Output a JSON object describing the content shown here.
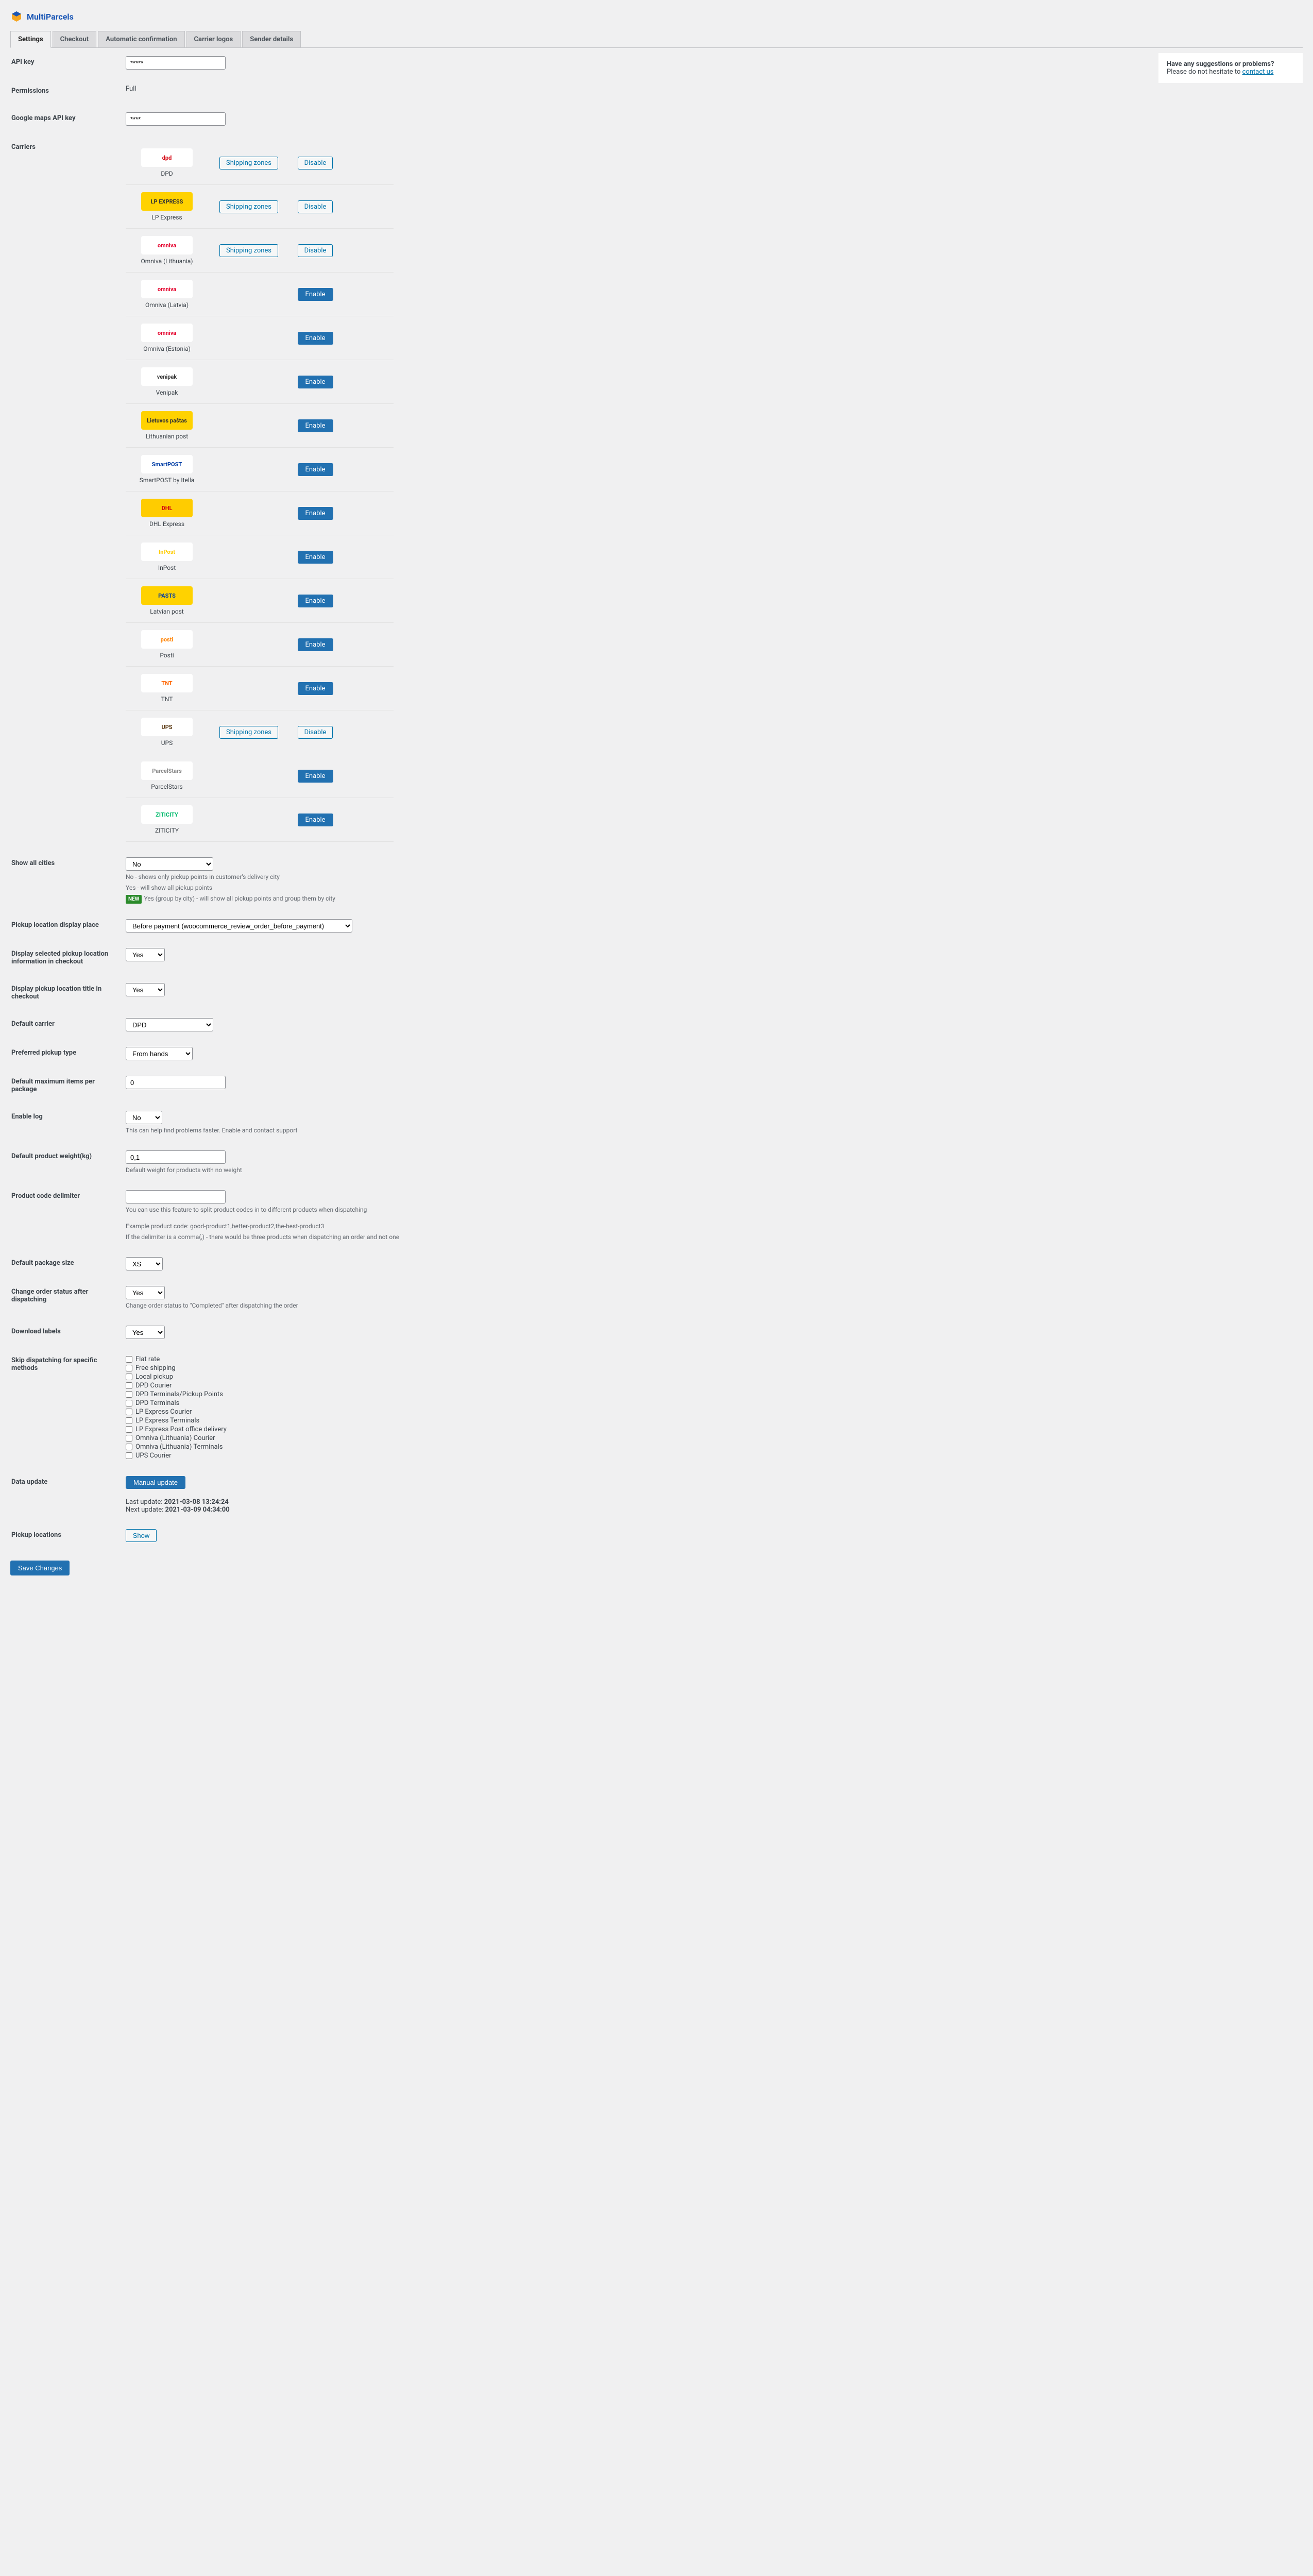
{
  "brand": "MultiParcels",
  "tabs": [
    "Settings",
    "Checkout",
    "Automatic confirmation",
    "Carrier logos",
    "Sender details"
  ],
  "activeTab": 0,
  "help": {
    "title": "Have any suggestions or problems?",
    "text": "Please do not hesitate to ",
    "link": "contact us"
  },
  "labels": {
    "apiKey": "API key",
    "permissions": "Permissions",
    "gmapsKey": "Google maps API key",
    "carriers": "Carriers",
    "showAllCities": "Show all cities",
    "pickupLocation": "Pickup location display place",
    "displaySelPickup": "Display selected pickup location information in checkout",
    "displayPickupTitle": "Display pickup location title in checkout",
    "defaultCarrier": "Default carrier",
    "prefPickup": "Preferred pickup type",
    "maxItems": "Default maximum items per package",
    "enableLog": "Enable log",
    "defWeight": "Default product weight(kg)",
    "prodDelim": "Product code delimiter",
    "defPkgSize": "Default package size",
    "changeOrder": "Change order status after dispatching",
    "downloadLabels": "Download labels",
    "skipDispatch": "Skip dispatching for specific methods",
    "dataUpdate": "Data update",
    "pickupLocations": "Pickup locations"
  },
  "values": {
    "apiKey": "*****",
    "permissions": "Full",
    "gmapsKey": "****",
    "showAllCities": "No",
    "pickupLocation": "Before payment (woocommerce_review_order_before_payment)",
    "displaySelPickup": "Yes",
    "displayPickupTitle": "Yes",
    "defaultCarrier": "DPD",
    "prefPickup": "From hands",
    "maxItems": "0",
    "enableLog": "No",
    "defWeight": "0,1",
    "prodDelim": "",
    "defPkgSize": "XS",
    "changeOrder": "Yes",
    "downloadLabels": "Yes"
  },
  "descriptions": {
    "showAll1": "No - shows only pickup points in customer's delivery city",
    "showAll2": "Yes - will show all pickup points",
    "showAll3": "Yes (group by city) - will show all pickup points and group them by city",
    "enableLog": "This can help find problems faster. Enable and contact support",
    "defWeight": "Default weight for products with no weight",
    "delim1": "You can use this feature to split product codes in to different products when dispatching",
    "delim2": "Example product code: good-product1,better-product2,the-best-product3",
    "delim3": "If the delimiter is a comma(,) - there would be three products when dispatching an order and not one",
    "changeOrder": "Change order status to \"Completed\" after dispatching the order"
  },
  "buttons": {
    "shippingZones": "Shipping zones",
    "enable": "Enable",
    "disable": "Disable",
    "manualUpdate": "Manual update",
    "show": "Show",
    "save": "Save Changes"
  },
  "badges": {
    "new": "NEW"
  },
  "dataUpdate": {
    "lastLabel": "Last update: ",
    "lastValue": "2021-03-08 13:24:24",
    "nextLabel": "Next update: ",
    "nextValue": "2021-03-09 04:34:00"
  },
  "carriers": [
    {
      "name": "DPD",
      "enabled": true,
      "logoBg": "#ffffff",
      "logoColor": "#d40511",
      "logoText": "dpd"
    },
    {
      "name": "LP Express",
      "enabled": true,
      "logoBg": "#ffd200",
      "logoColor": "#333",
      "logoText": "LP EXPRESS"
    },
    {
      "name": "Omniva (Lithuania)",
      "enabled": true,
      "logoBg": "#ffffff",
      "logoColor": "#e4002b",
      "logoText": "omniva"
    },
    {
      "name": "Omniva (Latvia)",
      "enabled": false,
      "logoBg": "#ffffff",
      "logoColor": "#e4002b",
      "logoText": "omniva"
    },
    {
      "name": "Omniva (Estonia)",
      "enabled": false,
      "logoBg": "#ffffff",
      "logoColor": "#e4002b",
      "logoText": "omniva"
    },
    {
      "name": "Venipak",
      "enabled": false,
      "logoBg": "#ffffff",
      "logoColor": "#333",
      "logoText": "venipak"
    },
    {
      "name": "Lithuanian post",
      "enabled": false,
      "logoBg": "#ffd200",
      "logoColor": "#333",
      "logoText": "Lietuvos paštas"
    },
    {
      "name": "SmartPOST by Itella",
      "enabled": false,
      "logoBg": "#ffffff",
      "logoColor": "#003da5",
      "logoText": "SmartPOST"
    },
    {
      "name": "DHL Express",
      "enabled": false,
      "logoBg": "#ffcc00",
      "logoColor": "#d40511",
      "logoText": "DHL"
    },
    {
      "name": "InPost",
      "enabled": false,
      "logoBg": "#ffffff",
      "logoColor": "#ffcc00",
      "logoText": "InPost"
    },
    {
      "name": "Latvian post",
      "enabled": false,
      "logoBg": "#ffd200",
      "logoColor": "#003da5",
      "logoText": "PASTS"
    },
    {
      "name": "Posti",
      "enabled": false,
      "logoBg": "#ffffff",
      "logoColor": "#ff8200",
      "logoText": "posti"
    },
    {
      "name": "TNT",
      "enabled": false,
      "logoBg": "#ffffff",
      "logoColor": "#ff6600",
      "logoText": "TNT"
    },
    {
      "name": "UPS",
      "enabled": true,
      "logoBg": "#ffffff",
      "logoColor": "#5b3a13",
      "logoText": "UPS"
    },
    {
      "name": "ParcelStars",
      "enabled": false,
      "logoBg": "#ffffff",
      "logoColor": "#888",
      "logoText": "ParcelStars"
    },
    {
      "name": "ZITICITY",
      "enabled": false,
      "logoBg": "#ffffff",
      "logoColor": "#00b96b",
      "logoText": "ZITICITY"
    }
  ],
  "skipMethods": [
    "Flat rate",
    "Free shipping",
    "Local pickup",
    "DPD Courier",
    "DPD Terminals/Pickup Points",
    "DPD Terminals",
    "LP Express Courier",
    "LP Express Terminals",
    "LP Express Post office delivery",
    "Omniva (Lithuania) Courier",
    "Omniva (Lithuania) Terminals",
    "UPS Courier"
  ]
}
